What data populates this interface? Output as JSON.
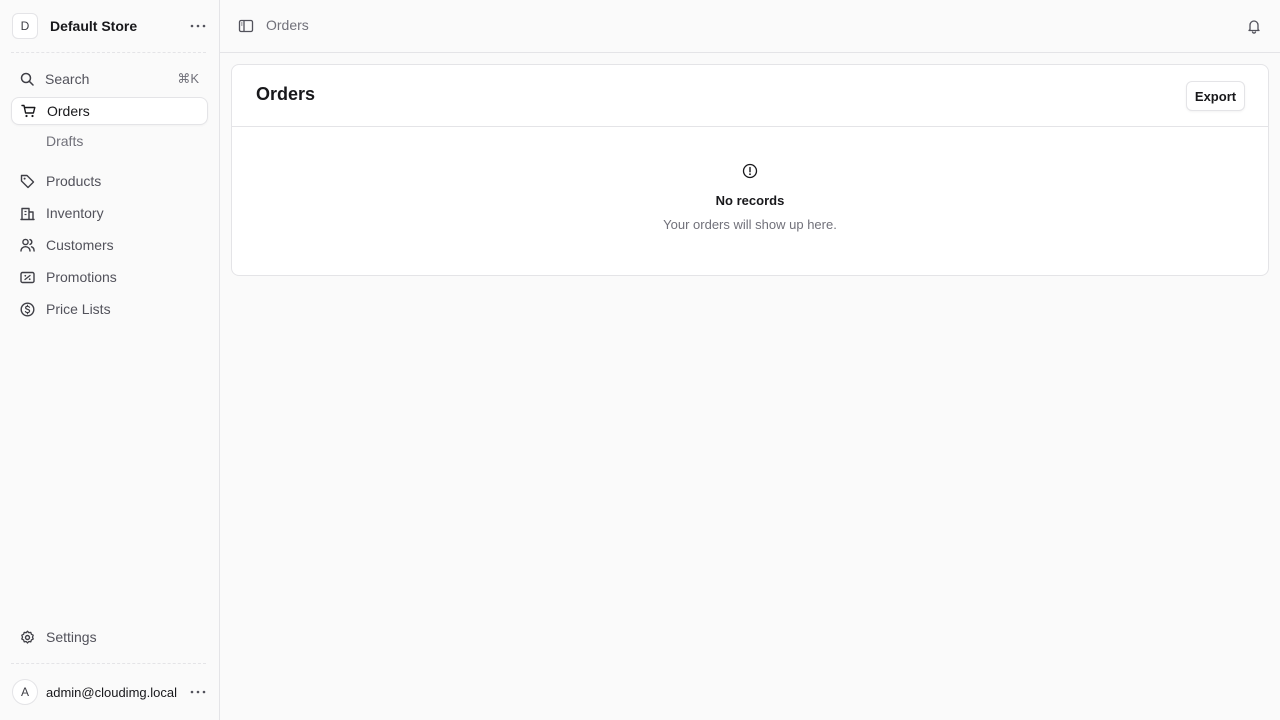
{
  "store": {
    "avatar_letter": "D",
    "name": "Default Store"
  },
  "sidebar": {
    "search": {
      "label": "Search",
      "shortcut": "⌘K"
    },
    "items": [
      {
        "label": "Orders",
        "icon": "cart-icon",
        "active": true
      },
      {
        "label": "Drafts",
        "sub": true
      },
      {
        "label": "Products",
        "icon": "tag-icon"
      },
      {
        "label": "Inventory",
        "icon": "building-icon"
      },
      {
        "label": "Customers",
        "icon": "users-icon"
      },
      {
        "label": "Promotions",
        "icon": "ticket-icon"
      },
      {
        "label": "Price Lists",
        "icon": "currency-icon"
      }
    ],
    "settings": {
      "label": "Settings",
      "icon": "gear-icon"
    },
    "user": {
      "avatar_letter": "A",
      "email": "admin@cloudimg.local"
    }
  },
  "topbar": {
    "breadcrumb": "Orders"
  },
  "main": {
    "title": "Orders",
    "export_label": "Export",
    "empty": {
      "title": "No records",
      "subtitle": "Your orders will show up here."
    }
  }
}
